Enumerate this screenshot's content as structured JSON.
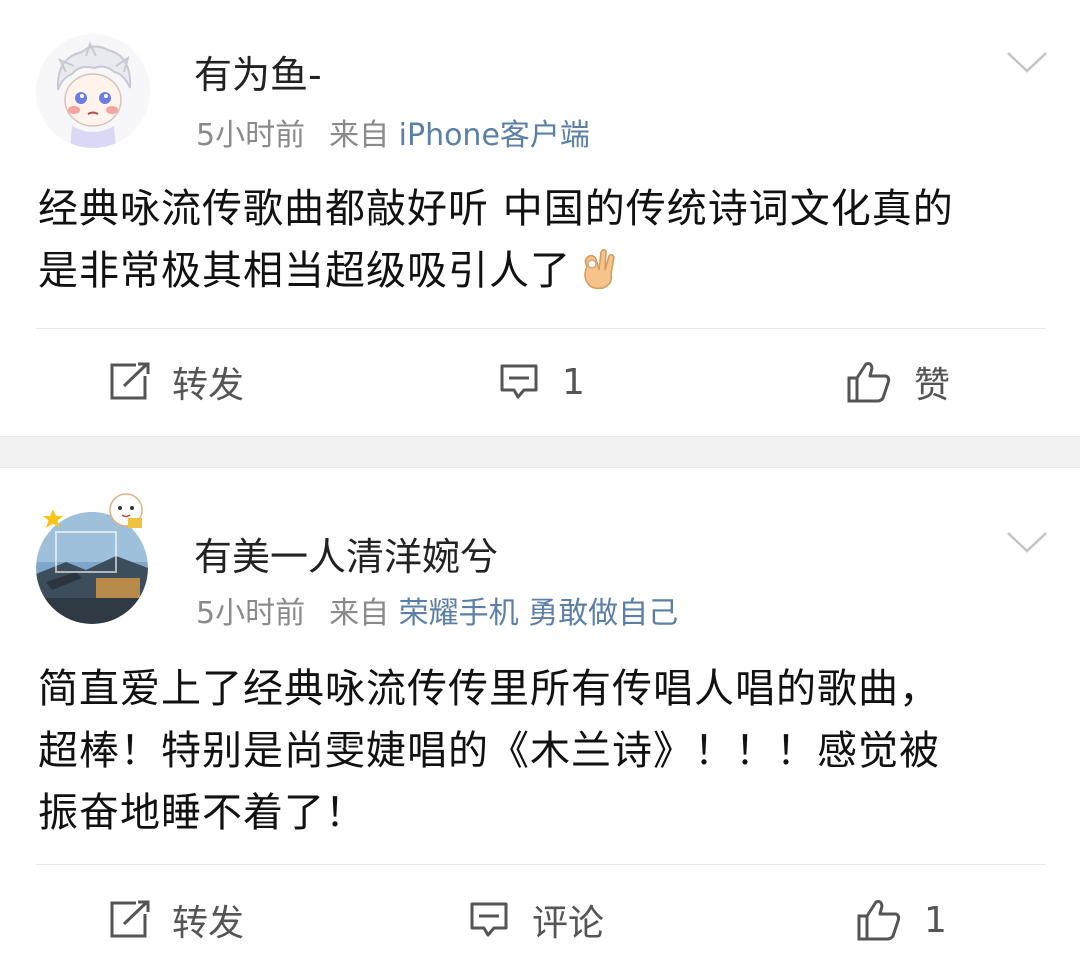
{
  "posts": [
    {
      "username": "有为鱼-",
      "time": "5小时前",
      "from_label": "来自",
      "source": "iPhone客户端",
      "content_lines": [
        "经典咏流传歌曲都敲好听 中国的传统诗词文化真的",
        "是非常极其相当超级吸引人了"
      ],
      "emoji": "ok-hand-emoji",
      "repost_label": "转发",
      "comment_label": "1",
      "like_label": "赞"
    },
    {
      "username": "有美一人清洋婉兮",
      "time": "5小时前",
      "from_label": "来自",
      "source": "荣耀手机 勇敢做自己",
      "content_lines": [
        "简直爱上了经典咏流传传里所有传唱人唱的歌曲，",
        "超棒！特别是尚雯婕唱的《木兰诗》！！！感觉被",
        "振奋地睡不着了！"
      ],
      "repost_label": "转发",
      "comment_label": "评论",
      "like_label": "1"
    }
  ],
  "colors": {
    "source_link": "#5b7fa6",
    "meta_text": "#8a8a8a",
    "separator_bg": "#f2f2f2"
  }
}
